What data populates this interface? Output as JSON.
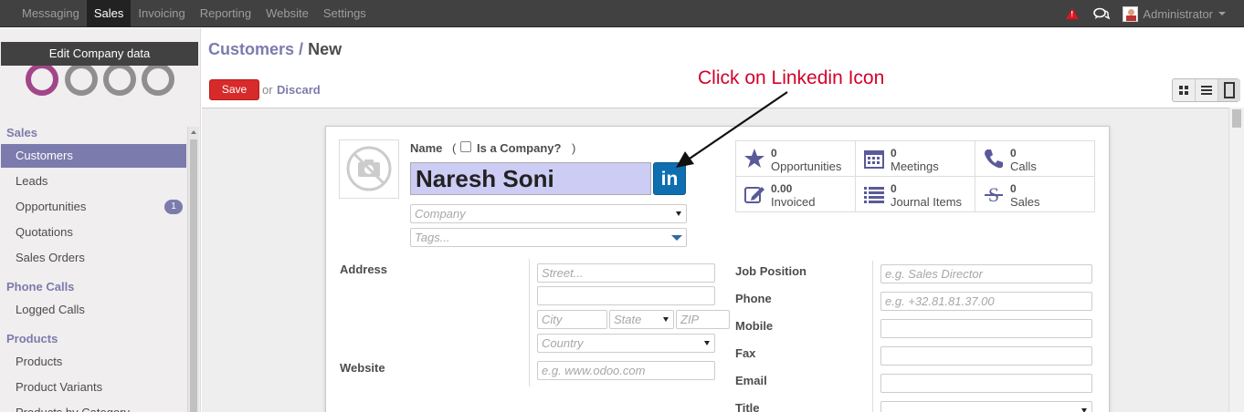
{
  "topbar": {
    "menu": [
      "Messaging",
      "Sales",
      "Invoicing",
      "Reporting",
      "Website",
      "Settings"
    ],
    "active": "Sales",
    "user": "Administrator"
  },
  "sidebar": {
    "edit_banner": "Edit Company data",
    "sections": [
      {
        "title": "Sales",
        "items": [
          {
            "label": "Customers",
            "active": true
          },
          {
            "label": "Leads"
          },
          {
            "label": "Opportunities",
            "badge": "1"
          },
          {
            "label": "Quotations"
          },
          {
            "label": "Sales Orders"
          }
        ]
      },
      {
        "title": "Phone Calls",
        "items": [
          {
            "label": "Logged Calls"
          }
        ]
      },
      {
        "title": "Products",
        "items": [
          {
            "label": "Products"
          },
          {
            "label": "Product Variants"
          },
          {
            "label": "Products by Category"
          }
        ]
      }
    ]
  },
  "breadcrumb": {
    "parent": "Customers",
    "sep": "/",
    "current": "New"
  },
  "actions": {
    "save": "Save",
    "or": "or",
    "discard": "Discard"
  },
  "annotation": "Click on Linkedin Icon",
  "form": {
    "name_label": "Name",
    "paren_open": "(",
    "paren_close": ")",
    "is_company_label": "Is a Company?",
    "name_value": "Naresh Soni",
    "linkedin_text": "in",
    "company_placeholder": "Company",
    "tags_placeholder": "Tags...",
    "address_label": "Address",
    "website_label": "Website",
    "street_placeholder": "Street...",
    "city_placeholder": "City",
    "state_placeholder": "State",
    "zip_placeholder": "ZIP",
    "country_placeholder": "Country",
    "website_placeholder": "e.g. www.odoo.com",
    "job_position_label": "Job Position",
    "job_position_placeholder": "e.g. Sales Director",
    "phone_label": "Phone",
    "phone_placeholder": "e.g. +32.81.81.37.00",
    "mobile_label": "Mobile",
    "fax_label": "Fax",
    "email_label": "Email",
    "title_label": "Title"
  },
  "stats": [
    {
      "value": "0",
      "label": "Opportunities",
      "icon": "star-icon"
    },
    {
      "value": "0",
      "label": "Meetings",
      "icon": "calendar-icon"
    },
    {
      "value": "0",
      "label": "Calls",
      "icon": "phone-icon"
    },
    {
      "value": "0.00",
      "label": "Invoiced",
      "icon": "edit-icon"
    },
    {
      "value": "0",
      "label": "Journal Items",
      "icon": "list-icon"
    },
    {
      "value": "0",
      "label": "Sales",
      "icon": "strikethrough-s-icon"
    }
  ],
  "colors": {
    "accent": "#7c7bad",
    "save": "#d72a2a",
    "annotation": "#d4002a",
    "linkedin": "#0e6eb0"
  }
}
